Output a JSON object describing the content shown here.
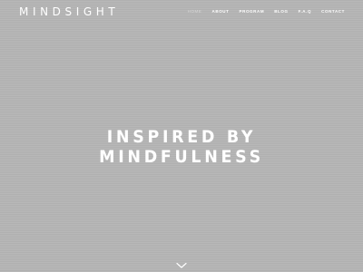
{
  "header": {
    "logo": "MINDSIGHT",
    "nav": [
      {
        "label": "HOME",
        "active": true
      },
      {
        "label": "ABOUT",
        "active": false
      },
      {
        "label": "PROGRAM",
        "active": false
      },
      {
        "label": "BLOG",
        "active": false
      },
      {
        "label": "F.A.Q",
        "active": false
      },
      {
        "label": "CONTACT",
        "active": false
      }
    ]
  },
  "hero": {
    "line1": "INSPIRED BY",
    "line2": "MINDFULNESS"
  },
  "scroll_indicator": {
    "icon": "chevron-down-icon"
  },
  "colors": {
    "background": "#b4b4b4",
    "text": "#ffffff",
    "nav_active": "#d8d8d8"
  }
}
